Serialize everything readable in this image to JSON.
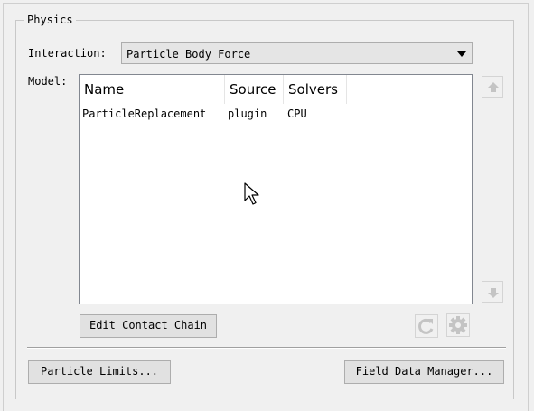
{
  "group": {
    "title": "Physics"
  },
  "interaction": {
    "label": "Interaction:",
    "value": "Particle Body Force"
  },
  "model": {
    "label": "Model:",
    "columns": [
      "Name",
      "Source",
      "Solvers"
    ],
    "rows": [
      {
        "name": "ParticleReplacement",
        "source": "plugin",
        "solvers": "CPU"
      }
    ]
  },
  "buttons": {
    "edit_contact_chain": "Edit Contact Chain",
    "particle_limits": "Particle Limits...",
    "field_data_manager": "Field Data Manager..."
  },
  "icons": {
    "move_up": "arrow-up-icon",
    "move_down": "arrow-down-icon",
    "refresh": "refresh-icon",
    "settings": "gear-icon"
  }
}
